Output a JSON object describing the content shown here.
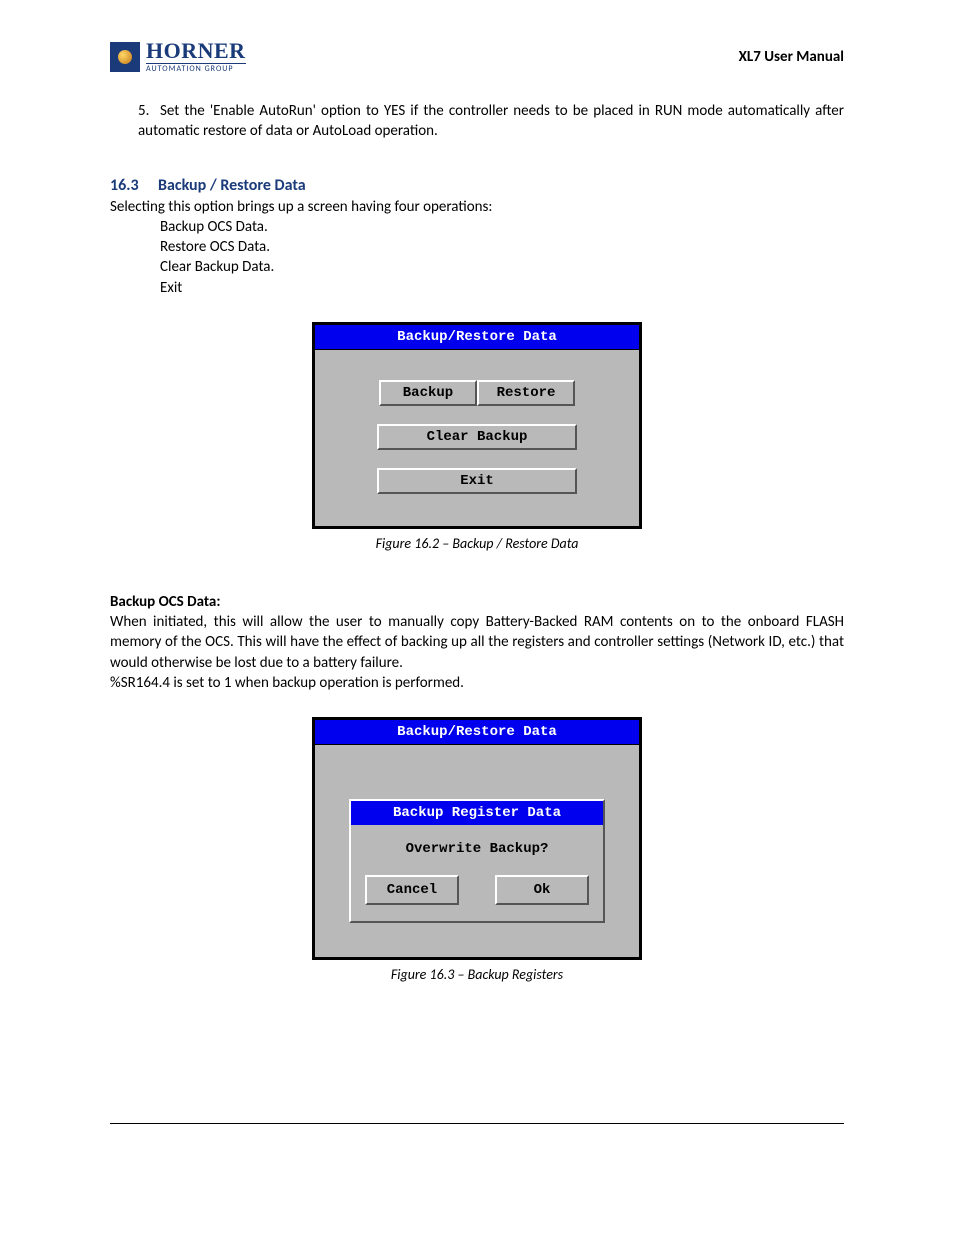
{
  "header": {
    "logo_name": "HORNER",
    "logo_sub": "AUTOMATION GROUP",
    "manual_title": "XL7 User Manual"
  },
  "item5_num": "5.",
  "item5_text": "Set the 'Enable AutoRun' option to YES if the controller needs to be placed in RUN mode automatically after automatic restore of data or AutoLoad operation.",
  "section": {
    "num": "16.3",
    "title": "Backup / Restore Data"
  },
  "intro": "Selecting this option brings up a screen having four operations:",
  "ops": [
    "Backup OCS Data.",
    "Restore OCS Data.",
    "Clear Backup Data.",
    "Exit"
  ],
  "screen1": {
    "title": "Backup/Restore Data",
    "btn_backup": "Backup",
    "btn_restore": "Restore",
    "btn_clear": "Clear Backup",
    "btn_exit": "Exit"
  },
  "fig1_caption": "Figure 16.2 – Backup / Restore Data",
  "subheading": "Backup OCS Data:",
  "para1": "When initiated, this will allow the user to manually copy Battery-Backed RAM contents on to the onboard FLASH memory of the OCS.  This will have the effect of backing up all the registers and controller settings (Network ID, etc.) that would otherwise be lost due to a battery failure.",
  "para2": "%SR164.4 is set to 1 when backup operation is performed.",
  "screen2": {
    "title": "Backup/Restore Data",
    "dialog_title": "Backup Register Data",
    "dialog_msg": "Overwrite Backup?",
    "btn_cancel": "Cancel",
    "btn_ok": "Ok"
  },
  "fig2_caption": "Figure 16.3 – Backup Registers"
}
